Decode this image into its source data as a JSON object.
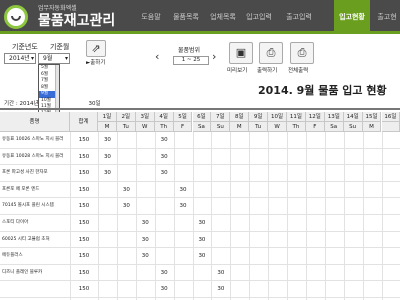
{
  "app": {
    "subtitle": "업무자동화엑셀",
    "title": "물품재고관리"
  },
  "nav": {
    "tabs": [
      {
        "label": "도움말",
        "active": false
      },
      {
        "label": "물품목록",
        "active": false
      },
      {
        "label": "업체목록",
        "active": false
      },
      {
        "label": "입고입력",
        "active": false
      },
      {
        "label": "출고입력",
        "active": false
      },
      {
        "label": "입고현황",
        "active": true
      },
      {
        "label": "출고현",
        "active": false
      }
    ]
  },
  "filters": {
    "year_label": "기준년도",
    "month_label": "기준월",
    "year_value": "2014년",
    "month_value": "9월",
    "month_options": [
      "5월",
      "6월",
      "7월",
      "8월",
      "9월",
      "10월",
      "11월",
      "12월"
    ],
    "month_selected": "9월"
  },
  "toolbar": {
    "partial_label": "►출하기",
    "range_label": "물품범위",
    "range_value": "1 ~ 25",
    "prev_icon": "chevron-left-icon",
    "next_icon": "chevron-right-icon",
    "buttons": [
      {
        "label": "미리보기",
        "icon": "monitor-icon"
      },
      {
        "label": "출력하기",
        "icon": "printer-icon"
      },
      {
        "label": "전체출력",
        "icon": "printer-all-icon"
      }
    ]
  },
  "report": {
    "title": "2014. 9월 물품 입고 현황",
    "period_start": "기간 : 2014년",
    "period_end": "30일"
  },
  "table": {
    "product_header": "품명",
    "total_header": "합계",
    "days": [
      {
        "num": "1일",
        "dow": "M"
      },
      {
        "num": "2일",
        "dow": "Tu"
      },
      {
        "num": "3일",
        "dow": "W"
      },
      {
        "num": "4일",
        "dow": "Th"
      },
      {
        "num": "5일",
        "dow": "F"
      },
      {
        "num": "6일",
        "dow": "Sa"
      },
      {
        "num": "7일",
        "dow": "Su"
      },
      {
        "num": "8일",
        "dow": "M"
      },
      {
        "num": "9일",
        "dow": "Tu"
      },
      {
        "num": "10일",
        "dow": "W"
      },
      {
        "num": "11일",
        "dow": "Th"
      },
      {
        "num": "12일",
        "dow": "F"
      },
      {
        "num": "13일",
        "dow": "Sa"
      },
      {
        "num": "14일",
        "dow": "Su"
      },
      {
        "num": "15일",
        "dow": "M"
      },
      {
        "num": "16일",
        "dow": ""
      }
    ],
    "rows": [
      {
        "name": "유동표 10026 스마노 지시 블러",
        "total": "150",
        "vals": [
          "30",
          "",
          "",
          "30",
          "",
          "",
          "",
          "",
          "",
          "",
          "",
          "",
          "",
          "",
          "",
          ""
        ]
      },
      {
        "name": "유동표 10028 스마노 지시 블러",
        "total": "150",
        "vals": [
          "30",
          "",
          "",
          "30",
          "",
          "",
          "",
          "",
          "",
          "",
          "",
          "",
          "",
          "",
          "",
          ""
        ]
      },
      {
        "name": "포론 파고성 사진 한자포",
        "total": "150",
        "vals": [
          "30",
          "",
          "",
          "30",
          "",
          "",
          "",
          "",
          "",
          "",
          "",
          "",
          "",
          "",
          "",
          ""
        ]
      },
      {
        "name": "포른포 페 포론 엔드",
        "total": "150",
        "vals": [
          "",
          "30",
          "",
          "",
          "30",
          "",
          "",
          "",
          "",
          "",
          "",
          "",
          "",
          "",
          "",
          ""
        ]
      },
      {
        "name": "70145 볼시포 플린 시스템",
        "total": "150",
        "vals": [
          "",
          "30",
          "",
          "",
          "30",
          "",
          "",
          "",
          "",
          "",
          "",
          "",
          "",
          "",
          "",
          ""
        ]
      },
      {
        "name": "스포티 다이아",
        "total": "150",
        "vals": [
          "",
          "",
          "30",
          "",
          "",
          "30",
          "",
          "",
          "",
          "",
          "",
          "",
          "",
          "",
          "",
          ""
        ]
      },
      {
        "name": "60025 시티 고뮬럼 초처",
        "total": "150",
        "vals": [
          "",
          "",
          "30",
          "",
          "",
          "30",
          "",
          "",
          "",
          "",
          "",
          "",
          "",
          "",
          "",
          ""
        ]
      },
      {
        "name": "에듀플러스",
        "total": "150",
        "vals": [
          "",
          "",
          "30",
          "",
          "",
          "30",
          "",
          "",
          "",
          "",
          "",
          "",
          "",
          "",
          "",
          ""
        ]
      },
      {
        "name": "디즈니 플레인 블루카",
        "total": "150",
        "vals": [
          "",
          "",
          "",
          "30",
          "",
          "",
          "30",
          "",
          "",
          "",
          "",
          "",
          "",
          "",
          "",
          ""
        ]
      },
      {
        "name": "",
        "total": "150",
        "vals": [
          "",
          "",
          "",
          "30",
          "",
          "",
          "30",
          "",
          "",
          "",
          "",
          "",
          "",
          "",
          "",
          ""
        ]
      }
    ]
  }
}
